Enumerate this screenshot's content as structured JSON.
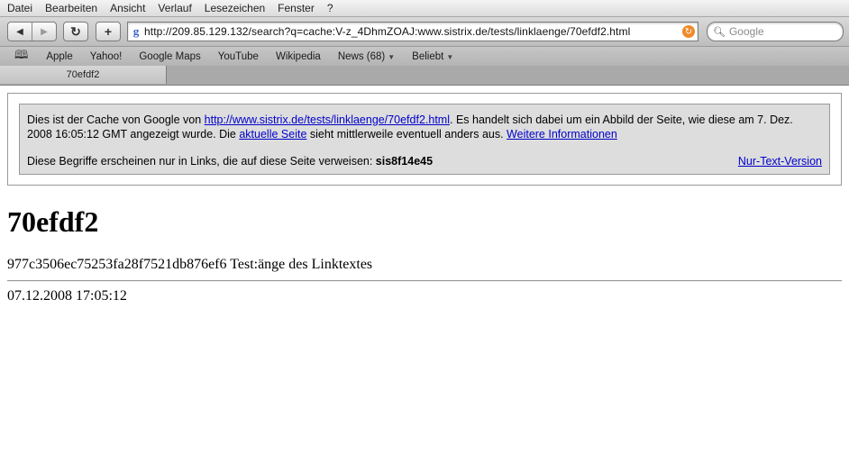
{
  "menu": [
    "Datei",
    "Bearbeiten",
    "Ansicht",
    "Verlauf",
    "Lesezeichen",
    "Fenster",
    "?"
  ],
  "toolbar": {
    "back_icon": "back-arrow-icon",
    "forward_icon": "forward-arrow-icon",
    "reload_glyph": "↻",
    "add_glyph": "+",
    "url": "http://209.85.129.132/search?q=cache:V-z_4DhmZOAJ:www.sistrix.de/tests/linklaenge/70efdf2.html",
    "search_placeholder": "Google"
  },
  "bookmarks": {
    "items": [
      {
        "label": "Apple"
      },
      {
        "label": "Yahoo!"
      },
      {
        "label": "Google Maps"
      },
      {
        "label": "YouTube"
      },
      {
        "label": "Wikipedia"
      },
      {
        "label": "News (68)"
      },
      {
        "label": "Beliebt"
      }
    ]
  },
  "tab": {
    "title": "70efdf2"
  },
  "cache": {
    "intro": "Dies ist der Cache von Google von ",
    "source_link": "http://www.sistrix.de/tests/linklaenge/70efdf2.html",
    "mid": ". Es handelt sich dabei um ein Abbild der Seite, wie diese am 7. Dez. 2008 16:05:12 GMT angezeigt wurde. Die ",
    "current_link": "aktuelle Seite",
    "after": " sieht mittlerweile eventuell anders aus. ",
    "more_link": "Weitere Informationen",
    "terms_text": "Diese Begriffe erscheinen nur in Links, die auf diese Seite verweisen: ",
    "terms_bold": "sis8f14e45",
    "text_only_link": "Nur-Text-Version"
  },
  "page": {
    "heading": "70efdf2",
    "line1": "977c3506ec75253fa28f7521db876ef6 Test:änge des Linktextes",
    "line2": "07.12.2008 17:05:12"
  }
}
